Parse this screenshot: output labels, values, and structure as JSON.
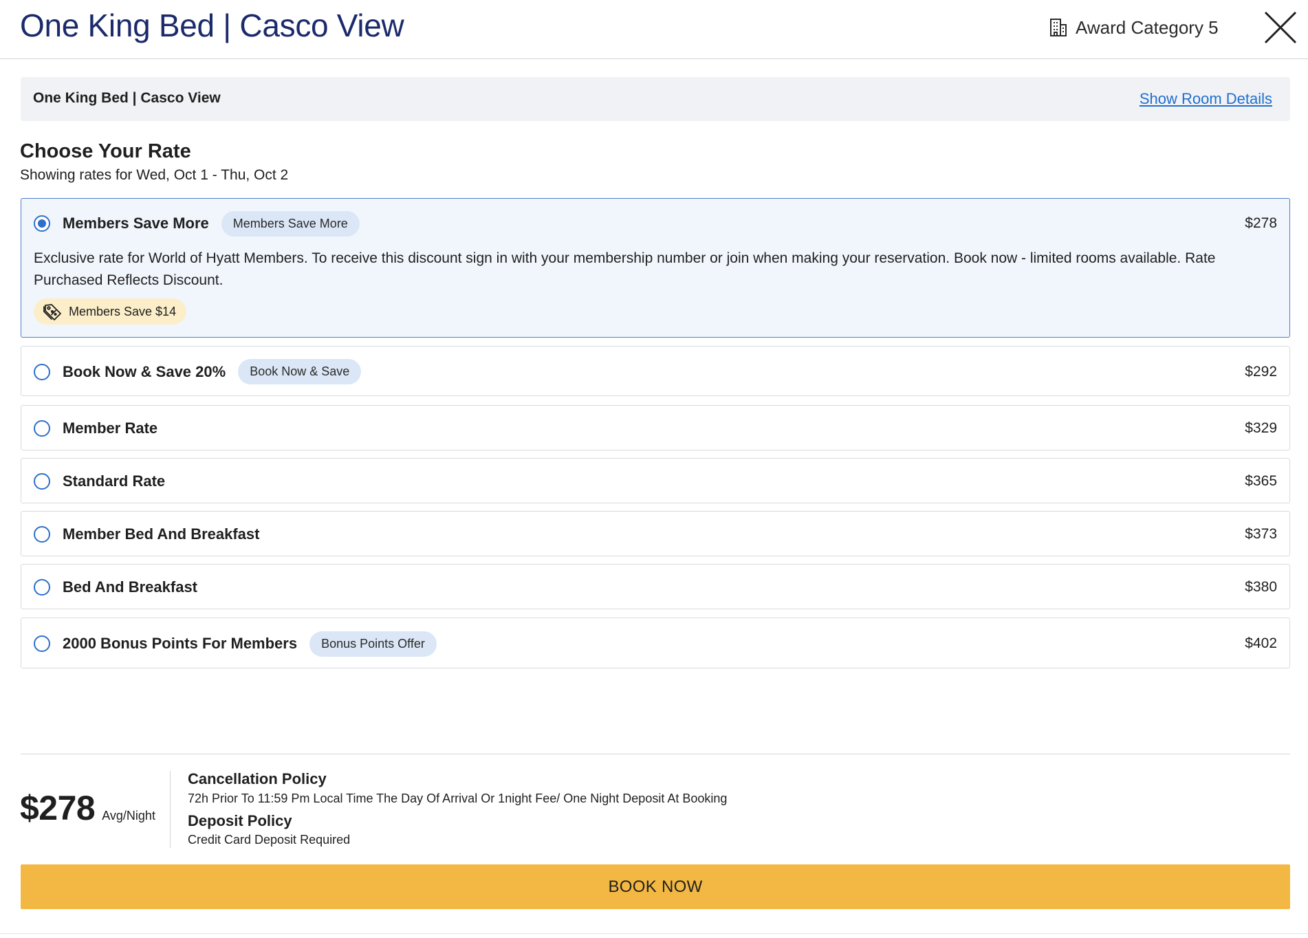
{
  "header": {
    "title": "One King Bed | Casco View",
    "award_label": "Award Category 5",
    "award_icon": "building-icon",
    "close_icon": "close-icon"
  },
  "room_bar": {
    "title": "One King Bed | Casco View",
    "details_link": "Show Room Details"
  },
  "rates_section": {
    "heading": "Choose Your Rate",
    "dates": "Showing rates for Wed, Oct 1 - Thu, Oct 2"
  },
  "rates": [
    {
      "name": "Members Save More",
      "tag": "Members Save More",
      "price": "$278",
      "selected": true,
      "description": "Exclusive rate for World of Hyatt Members. To receive this discount sign in with your membership number or join when making your reservation. Book now - limited rooms available. Rate Purchased Reflects Discount.",
      "savings": "Members Save $14",
      "savings_icon": "discount-tag-icon"
    },
    {
      "name": "Book Now & Save 20%",
      "tag": "Book Now & Save",
      "price": "$292",
      "selected": false
    },
    {
      "name": "Member Rate",
      "price": "$329",
      "selected": false
    },
    {
      "name": "Standard Rate",
      "price": "$365",
      "selected": false
    },
    {
      "name": "Member Bed And Breakfast",
      "price": "$373",
      "selected": false
    },
    {
      "name": "Bed And Breakfast",
      "price": "$380",
      "selected": false
    },
    {
      "name": "2000 Bonus Points For Members",
      "tag": "Bonus Points Offer",
      "price": "$402",
      "selected": false
    }
  ],
  "summary": {
    "price": "$278",
    "per_night": "Avg/Night",
    "cancellation_title": "Cancellation Policy",
    "cancellation_text": "72h Prior To 11:59 Pm Local Time The Day Of Arrival Or 1night Fee/ One Night Deposit At Booking",
    "deposit_title": "Deposit Policy",
    "deposit_text": "Credit Card Deposit Required",
    "book_button": "BOOK NOW"
  },
  "colors": {
    "title": "#1b2a6b",
    "link": "#1f6fd1",
    "radio": "#2d6fc9",
    "selected_border": "#4a7fc8",
    "selected_bg": "#f1f6fd",
    "tag_bg": "#dbe7f6",
    "savings_bg": "#fbeec9",
    "book_button": "#f3b843"
  }
}
